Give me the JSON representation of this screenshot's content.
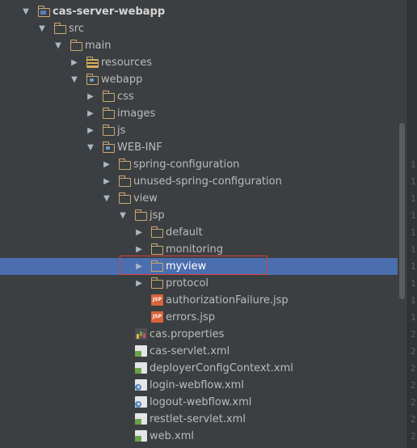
{
  "tree": {
    "items": [
      {
        "label": "cas-server-webapp",
        "depth": 0,
        "arrow": "open",
        "icon": "module-folder-icon",
        "bold": true
      },
      {
        "label": "src",
        "depth": 1,
        "arrow": "open",
        "icon": "folder-icon"
      },
      {
        "label": "main",
        "depth": 2,
        "arrow": "open",
        "icon": "folder-icon"
      },
      {
        "label": "resources",
        "depth": 3,
        "arrow": "closed",
        "icon": "resources-folder-icon"
      },
      {
        "label": "webapp",
        "depth": 3,
        "arrow": "open",
        "icon": "web-folder-icon"
      },
      {
        "label": "css",
        "depth": 4,
        "arrow": "closed",
        "icon": "folder-icon"
      },
      {
        "label": "images",
        "depth": 4,
        "arrow": "closed",
        "icon": "folder-icon"
      },
      {
        "label": "js",
        "depth": 4,
        "arrow": "closed",
        "icon": "folder-icon"
      },
      {
        "label": "WEB-INF",
        "depth": 4,
        "arrow": "open",
        "icon": "web-folder-icon"
      },
      {
        "label": "spring-configuration",
        "depth": 5,
        "arrow": "closed",
        "icon": "folder-icon"
      },
      {
        "label": "unused-spring-configuration",
        "depth": 5,
        "arrow": "closed",
        "icon": "folder-icon"
      },
      {
        "label": "view",
        "depth": 5,
        "arrow": "open",
        "icon": "folder-icon"
      },
      {
        "label": "jsp",
        "depth": 6,
        "arrow": "open",
        "icon": "folder-icon"
      },
      {
        "label": "default",
        "depth": 7,
        "arrow": "closed",
        "icon": "folder-icon"
      },
      {
        "label": "monitoring",
        "depth": 7,
        "arrow": "closed",
        "icon": "folder-icon"
      },
      {
        "label": "myview",
        "depth": 7,
        "arrow": "closed",
        "icon": "folder-icon",
        "selected": true
      },
      {
        "label": "protocol",
        "depth": 7,
        "arrow": "closed",
        "icon": "folder-icon"
      },
      {
        "label": "authorizationFailure.jsp",
        "depth": 7,
        "arrow": "none",
        "icon": "jsp-file-icon"
      },
      {
        "label": "errors.jsp",
        "depth": 7,
        "arrow": "none",
        "icon": "jsp-file-icon"
      },
      {
        "label": "cas.properties",
        "depth": 6,
        "arrow": "none",
        "icon": "properties-file-icon"
      },
      {
        "label": "cas-servlet.xml",
        "depth": 6,
        "arrow": "none",
        "icon": "spring-xml-icon"
      },
      {
        "label": "deployerConfigContext.xml",
        "depth": 6,
        "arrow": "none",
        "icon": "spring-xml-icon"
      },
      {
        "label": "login-webflow.xml",
        "depth": 6,
        "arrow": "none",
        "icon": "webflow-xml-icon"
      },
      {
        "label": "logout-webflow.xml",
        "depth": 6,
        "arrow": "none",
        "icon": "webflow-xml-icon"
      },
      {
        "label": "restlet-servlet.xml",
        "depth": 6,
        "arrow": "none",
        "icon": "spring-xml-icon"
      },
      {
        "label": "web.xml",
        "depth": 6,
        "arrow": "none",
        "icon": "spring-xml-icon"
      }
    ]
  },
  "jsp_badge": "JSP",
  "gutter": {
    "lines": [
      "",
      "",
      "",
      "",
      "",
      "",
      "",
      "",
      "",
      "1",
      "1",
      "1",
      "1",
      "1",
      "1",
      "1",
      "1",
      "1",
      "1",
      "2",
      "2",
      "2",
      "2",
      "2",
      "2",
      "2"
    ]
  },
  "colors": {
    "background": "#3c3f41",
    "selection": "#4b6eaf",
    "highlight_border": "#d9413b",
    "folder": "#c8a874"
  }
}
